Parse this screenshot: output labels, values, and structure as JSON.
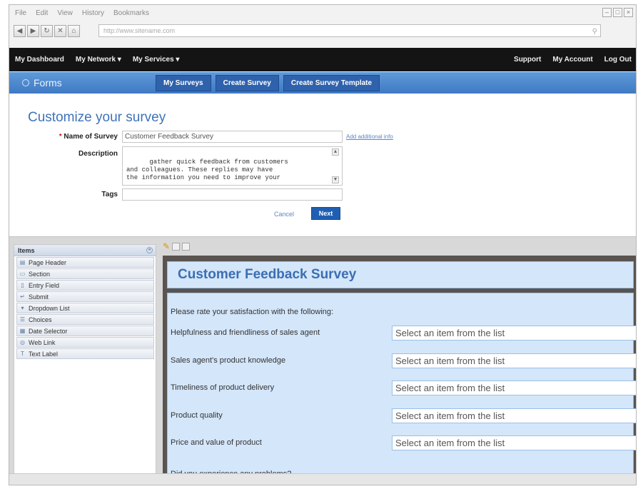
{
  "browser": {
    "menu": [
      "File",
      "Edit",
      "View",
      "History",
      "Bookmarks"
    ],
    "url_text": "http://www.sitename.com"
  },
  "topnav": {
    "left": [
      "My Dashboard",
      "My Network ▾",
      "My Services ▾"
    ],
    "right": [
      "Support",
      "My Account",
      "Log Out"
    ]
  },
  "subnav": {
    "title": "Forms",
    "tabs": [
      "My Surveys",
      "Create Survey",
      "Create Survey Template"
    ]
  },
  "form": {
    "page_title": "Customize your survey",
    "name_label": "Name of Survey",
    "name_value": "Customer Feedback Survey",
    "extra_link": "Add additional info",
    "description_label": "Description",
    "description_value": "gather quick feedback from customers\nand colleagues. These replies may have\nthe information you need to improve your",
    "tags_label": "Tags",
    "cancel_label": "Cancel",
    "next_label": "Next"
  },
  "items_panel": {
    "title": "Items",
    "items": [
      {
        "label": "Page Header",
        "icon": "page-header-icon"
      },
      {
        "label": "Section",
        "icon": "section-icon"
      },
      {
        "label": "Entry Field",
        "icon": "entry-field-icon"
      },
      {
        "label": "Submit",
        "icon": "submit-icon"
      },
      {
        "label": "Dropdown List",
        "icon": "dropdown-list-icon"
      },
      {
        "label": "Choices",
        "icon": "choices-icon"
      },
      {
        "label": "Date Selector",
        "icon": "date-selector-icon"
      },
      {
        "label": "Web Link",
        "icon": "web-link-icon"
      },
      {
        "label": "Text Label",
        "icon": "text-label-icon"
      }
    ]
  },
  "survey": {
    "title": "Customer Feedback Survey",
    "prompt": "Please rate your satisfaction with the following:",
    "questions": [
      {
        "label": "Helpfulness and friendliness of sales agent",
        "placeholder": "Select an item from the list"
      },
      {
        "label": "Sales agent's product knowledge",
        "placeholder": "Select an item from the list"
      },
      {
        "label": "Timeliness of product delivery",
        "placeholder": "Select an item from the list"
      },
      {
        "label": "Product quality",
        "placeholder": "Select an item from the list"
      },
      {
        "label": "Price and value of product",
        "placeholder": "Select an item from the list"
      }
    ],
    "problems_prompt": "Did you experience any problems?"
  },
  "colors": {
    "topnav_bg": "#141414",
    "subnav_blue": "#4a85cc",
    "tab_blue": "#2f62ac",
    "survey_bg": "#d4e6fa",
    "title_blue": "#3f73b9"
  }
}
